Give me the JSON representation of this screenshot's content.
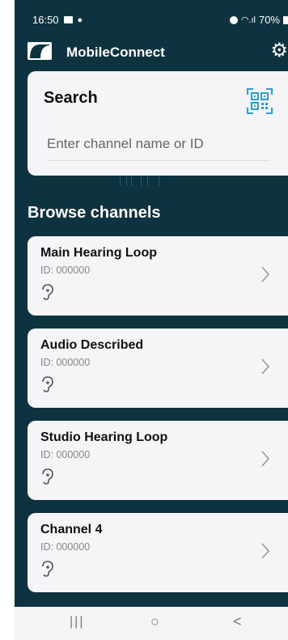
{
  "status_bar": {
    "time": "16:50",
    "battery": "70%"
  },
  "app": {
    "title": "MobileConnect"
  },
  "search": {
    "title": "Search",
    "placeholder": "Enter channel name or ID"
  },
  "browse": {
    "title": "Browse channels",
    "channels": [
      {
        "name": "Main Hearing Loop",
        "id": "ID: 000000"
      },
      {
        "name": "Audio Described",
        "id": "ID: 000000"
      },
      {
        "name": "Studio Hearing Loop",
        "id": "ID: 000000"
      },
      {
        "name": "Channel 4",
        "id": "ID: 000000"
      }
    ]
  },
  "nav": {
    "recents": "|||",
    "home": "○",
    "back": "<"
  },
  "colors": {
    "background": "#0d3340",
    "card": "#f5f4f6",
    "qr_accent": "#2a9fd6"
  }
}
